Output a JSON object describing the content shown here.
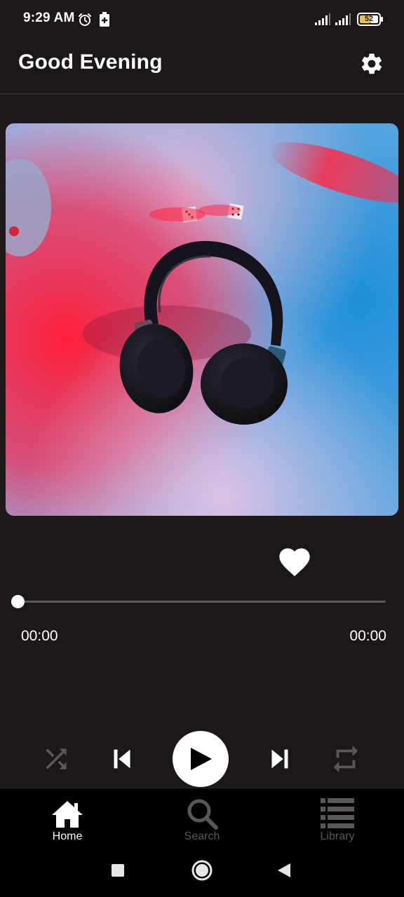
{
  "status_bar": {
    "time": "9:29 AM",
    "battery": "52"
  },
  "header": {
    "title": "Good Evening",
    "settings_icon": "gear-icon"
  },
  "player": {
    "like_icon": "heart-icon",
    "progress": 0,
    "current_time": "00:00",
    "total_time": "00:00",
    "controls": [
      "shuffle-icon",
      "skip-previous-icon",
      "play-icon",
      "skip-next-icon",
      "repeat-icon"
    ]
  },
  "bottom_nav": {
    "items": [
      {
        "label": "Home",
        "icon": "home-icon",
        "active": true
      },
      {
        "label": "Search",
        "icon": "search-icon",
        "active": false
      },
      {
        "label": "Library",
        "icon": "library-icon",
        "active": false
      }
    ]
  },
  "colors": {
    "background": "#1b1817",
    "nav_background": "#000000",
    "active": "#ffffff",
    "inactive": "#5b5757",
    "track": "#5e5a59"
  }
}
